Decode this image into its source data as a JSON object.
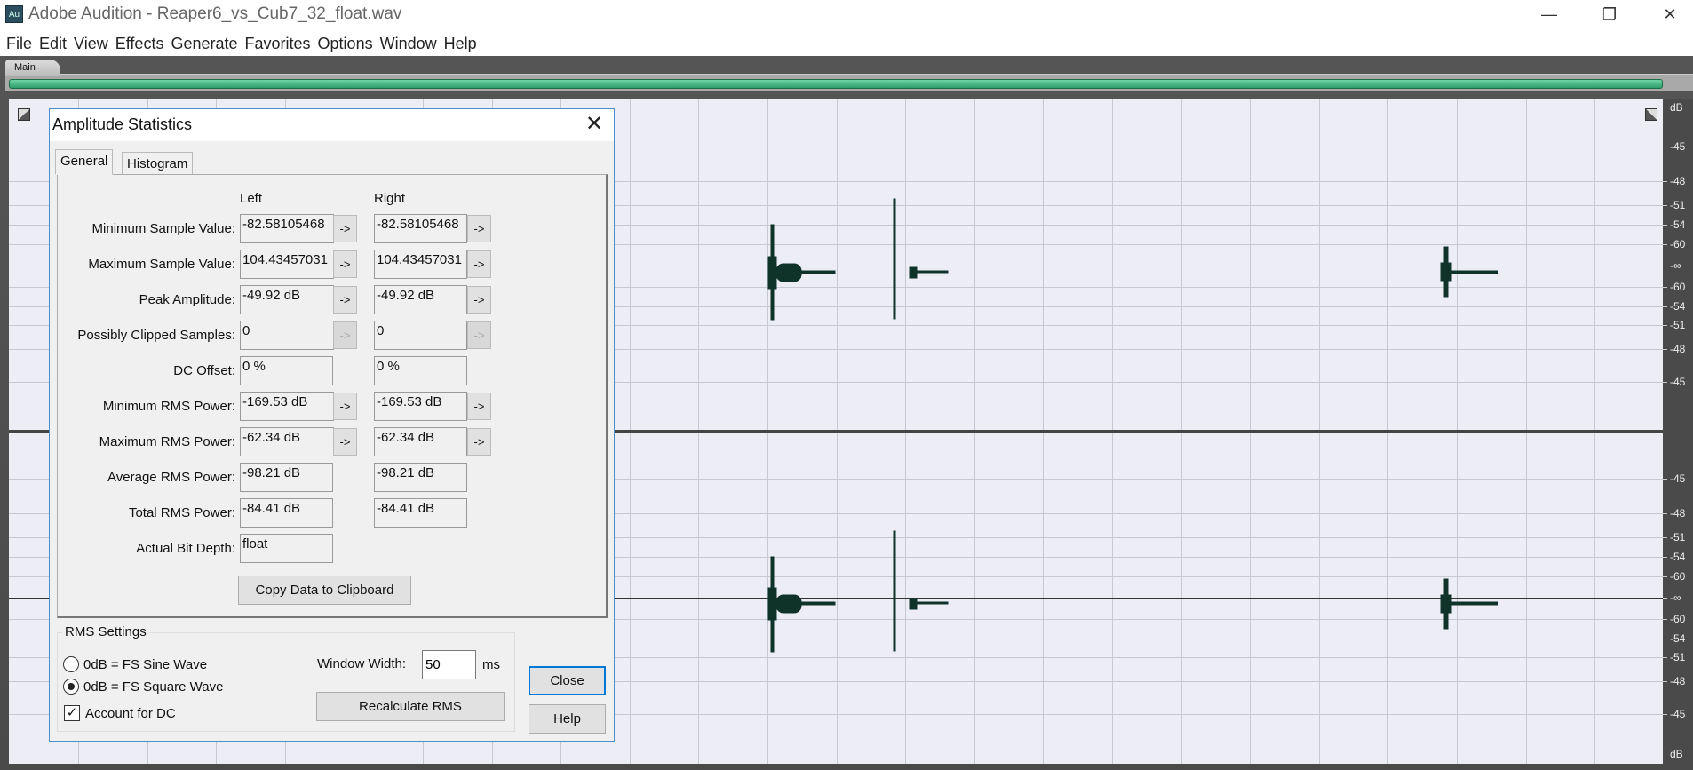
{
  "window": {
    "title": "Adobe Audition - Reaper6_vs_Cub7_32_float.wav",
    "app_icon": "Au"
  },
  "menu": [
    "File",
    "Edit",
    "View",
    "Effects",
    "Generate",
    "Favorites",
    "Options",
    "Window",
    "Help"
  ],
  "panel_tab": "Main",
  "db_ruler": {
    "unit": "dB",
    "labels": [
      "-45",
      "-48",
      "-51",
      "-54",
      "-60",
      "-∞",
      "-60",
      "-54",
      "-51",
      "-48",
      "-45"
    ]
  },
  "dialog": {
    "title": "Amplitude Statistics",
    "tabs": [
      "General",
      "Histogram"
    ],
    "col_left": "Left",
    "col_right": "Right",
    "rows": [
      {
        "label": "Minimum Sample Value:",
        "left": "-82.58105468",
        "right": "-82.58105468",
        "arrow": "->",
        "arrow_state": "enabled"
      },
      {
        "label": "Maximum Sample Value:",
        "left": "104.43457031",
        "right": "104.43457031",
        "arrow": "->",
        "arrow_state": "enabled"
      },
      {
        "label": "Peak Amplitude:",
        "left": "-49.92 dB",
        "right": "-49.92 dB",
        "arrow": "->",
        "arrow_state": "enabled"
      },
      {
        "label": "Possibly Clipped Samples:",
        "left": "0",
        "right": "0",
        "arrow": "->",
        "arrow_state": "disabled"
      },
      {
        "label": "DC Offset:",
        "left": "0 %",
        "right": "0 %",
        "arrow": null
      },
      {
        "label": "Minimum RMS Power:",
        "left": "-169.53 dB",
        "right": "-169.53 dB",
        "arrow": "->",
        "arrow_state": "enabled"
      },
      {
        "label": "Maximum RMS Power:",
        "left": "-62.34 dB",
        "right": "-62.34 dB",
        "arrow": "->",
        "arrow_state": "enabled"
      },
      {
        "label": "Average RMS Power:",
        "left": "-98.21 dB",
        "right": "-98.21 dB",
        "arrow": null
      },
      {
        "label": "Total RMS Power:",
        "left": "-84.41 dB",
        "right": "-84.41 dB",
        "arrow": null
      },
      {
        "label": "Actual Bit Depth:",
        "left": "float",
        "right": null,
        "arrow": null
      }
    ],
    "copy_button": "Copy Data to Clipboard",
    "rms": {
      "group_label": "RMS Settings",
      "option_sine": "0dB = FS Sine Wave",
      "option_square": "0dB = FS Square Wave",
      "selected": "square",
      "account_dc_label": "Account for DC",
      "account_dc_checked": true,
      "window_width_label": "Window Width:",
      "window_width_value": "50",
      "window_width_unit": "ms",
      "recalc_button": "Recalculate RMS"
    },
    "close_button": "Close",
    "help_button": "Help"
  }
}
